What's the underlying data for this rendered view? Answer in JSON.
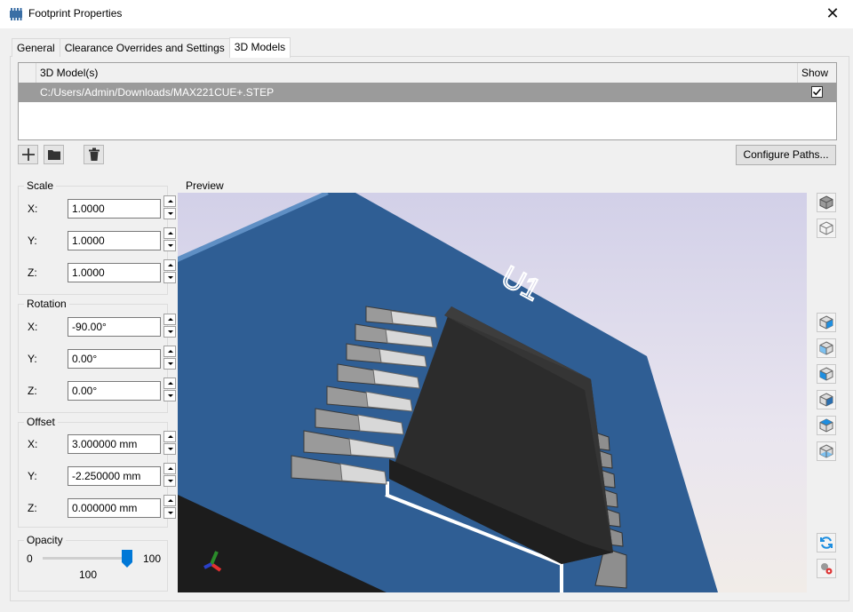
{
  "window": {
    "title": "Footprint Properties",
    "close_glyph": "✕"
  },
  "tabs": [
    {
      "label": "General"
    },
    {
      "label": "Clearance Overrides and Settings"
    },
    {
      "label": "3D Models",
      "active": true
    }
  ],
  "models_table": {
    "headers": {
      "model": "3D Model(s)",
      "show": "Show"
    },
    "rows": [
      {
        "path": "C:/Users/Admin/Downloads/MAX221CUE+.STEP",
        "show": true
      }
    ]
  },
  "toolbar": {
    "add_icon": "plus-icon",
    "browse_icon": "folder-icon",
    "delete_icon": "trash-icon",
    "configure_label": "Configure Paths..."
  },
  "scale": {
    "title": "Scale",
    "x_label": "X:",
    "y_label": "Y:",
    "z_label": "Z:",
    "x": "1.0000",
    "y": "1.0000",
    "z": "1.0000"
  },
  "rotation": {
    "title": "Rotation",
    "x_label": "X:",
    "y_label": "Y:",
    "z_label": "Z:",
    "x": "-90.00°",
    "y": "0.00°",
    "z": "0.00°"
  },
  "offset": {
    "title": "Offset",
    "x_label": "X:",
    "y_label": "Y:",
    "z_label": "Z:",
    "x": "3.000000 mm",
    "y": "-2.250000 mm",
    "z": "0.000000 mm"
  },
  "opacity": {
    "title": "Opacity",
    "min": "0",
    "max": "100",
    "value": "100"
  },
  "preview": {
    "label": "Preview",
    "silkscreen_text": "U1"
  },
  "colors": {
    "accent": "#0078d7",
    "board": "#2f5e94",
    "chip": "#2b2b2b",
    "selected_row": "#9b9b9b"
  },
  "side_toolbar_icons": [
    "view-cube-shaded-icon",
    "view-cube-outline-icon",
    "view-front-icon",
    "view-back-icon",
    "view-left-icon",
    "view-right-icon",
    "view-top-icon",
    "view-bottom-icon",
    "reload-icon",
    "settings-icon"
  ]
}
